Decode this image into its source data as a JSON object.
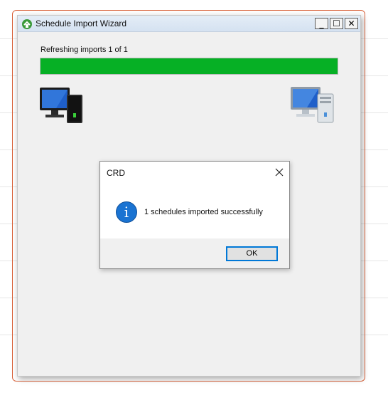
{
  "window": {
    "title": "Schedule Import Wizard",
    "controls": {
      "minimize": "_",
      "maximize": "☐",
      "close": "✕"
    }
  },
  "progress": {
    "status_text": "Refreshing imports 1 of 1",
    "percent": 100,
    "fill_color": "#06b025"
  },
  "icons": {
    "source_computer": "desktop-computer-icon",
    "target_computer": "desktop-computer-icon"
  },
  "dialog": {
    "title": "CRD",
    "message": "1 schedules imported successfully",
    "info_glyph": "i",
    "ok_label": "OK",
    "accent_color": "#0078d7"
  }
}
